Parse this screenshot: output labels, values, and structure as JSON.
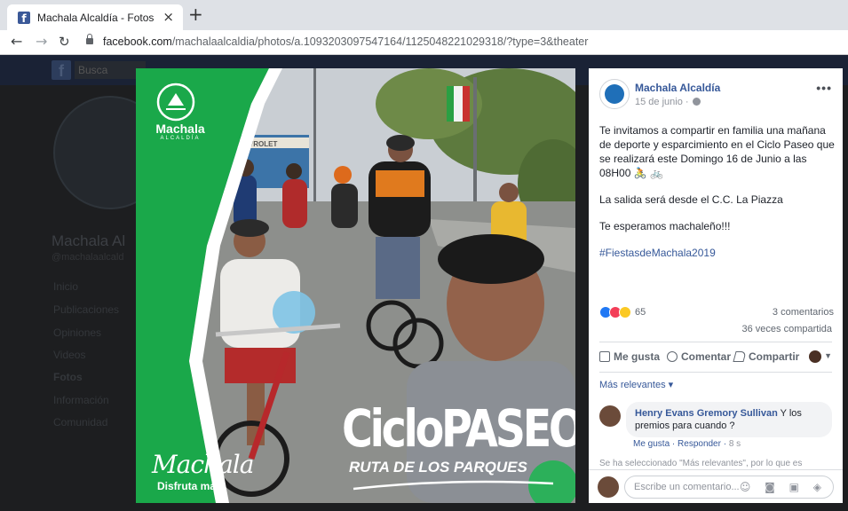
{
  "browser": {
    "tab_title": "Machala Alcaldía - Fotos",
    "tab_close": "×",
    "new_tab": "+",
    "url_host": "facebook.com",
    "url_path": "/machalaalcaldia/photos/a.1093203097547164/1125048221029318/?type=3&theater"
  },
  "background_page": {
    "search_placeholder": "Busca",
    "page_name": "Machala Al",
    "handle": "@machalaalcald",
    "menu": [
      "Inicio",
      "Publicaciones",
      "Opiniones",
      "Videos",
      "Fotos",
      "Información",
      "Comunidad"
    ]
  },
  "photo": {
    "logo_top": "Machala",
    "logo_top_sub": "ALCALDÍA",
    "storefront_sign": "CHEVROLET",
    "title": "CicloPASEO",
    "subtitle": "RUTA DE LOS PARQUES",
    "logo_bottom": "Machala",
    "logo_bottom_sub": "Disfruta más"
  },
  "post": {
    "author": "Machala Alcaldía",
    "date": "15 de junio ·",
    "more": "•••",
    "paragraphs": [
      "Te invitamos a compartir en familia una mañana de deporte y esparcimiento en el Ciclo Paseo que se realizará este Domingo 16 de Junio a las 08H00 🚴 🚲",
      "La salida será desde el C.C. La Piazza",
      "Te esperamos machaleño!!!"
    ],
    "hashtag": "#FiestasdeMachala2019",
    "reactions_count": "65",
    "comments_count": "3 comentarios",
    "shares_count": "36 veces compartida",
    "actions": {
      "like": "Me gusta",
      "comment": "Comentar",
      "share": "Compartir"
    },
    "sort_label": "Más relevantes ▾",
    "comments": [
      {
        "author": "Henry Evans Gremory Sullivan",
        "text": "Y los premios para cuando ?",
        "like": "Me gusta",
        "reply": "Responder",
        "time": "8 s"
      }
    ],
    "note": "Se ha seleccionado \"Más relevantes\", por lo que es",
    "compose_placeholder": "Escribe un comentario...",
    "compose_icons": "☺ ◙ ▣ ◈"
  },
  "colors": {
    "brand_green": "#1aa84a",
    "facebook_blue": "#365899"
  }
}
